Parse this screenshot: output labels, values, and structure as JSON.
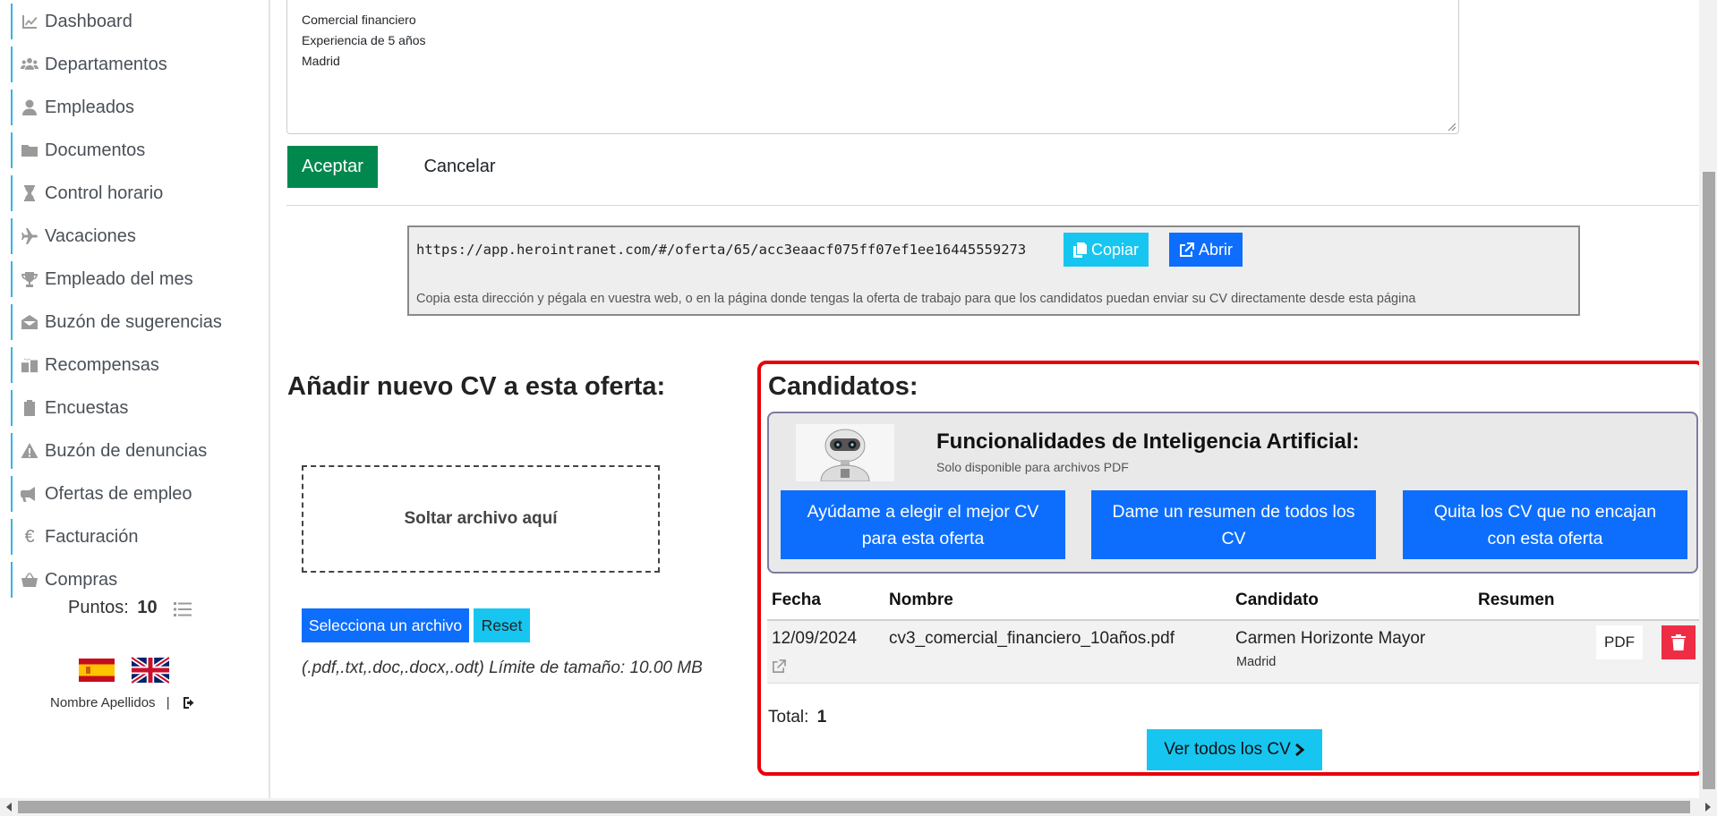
{
  "sidebar": {
    "items": [
      {
        "label": "Dashboard",
        "icon": "chart-line-icon"
      },
      {
        "label": "Departamentos",
        "icon": "users-icon"
      },
      {
        "label": "Empleados",
        "icon": "user-icon"
      },
      {
        "label": "Documentos",
        "icon": "folder-icon"
      },
      {
        "label": "Control horario",
        "icon": "hourglass-icon"
      },
      {
        "label": "Vacaciones",
        "icon": "plane-icon"
      },
      {
        "label": "Empleado del mes",
        "icon": "trophy-icon"
      },
      {
        "label": "Buzón de sugerencias",
        "icon": "envelope-open-icon"
      },
      {
        "label": "Recompensas",
        "icon": "gifts-icon"
      },
      {
        "label": "Encuestas",
        "icon": "clipboard-icon"
      },
      {
        "label": "Buzón de denuncias",
        "icon": "warning-icon"
      },
      {
        "label": "Ofertas de empleo",
        "icon": "bullhorn-icon"
      },
      {
        "label": "Facturación",
        "icon": "euro-icon"
      },
      {
        "label": "Compras",
        "icon": "basket-icon"
      }
    ],
    "points_label": "Puntos:",
    "points_value": "10",
    "user_name": "Nombre Apellidos",
    "separator": "|"
  },
  "form": {
    "description_lines": [
      "Comercial financiero",
      "Experiencia de 5 años",
      "Madrid"
    ],
    "accept_label": "Aceptar",
    "cancel_label": "Cancelar"
  },
  "share": {
    "url": "https://app.herointranet.com/#/oferta/65/acc3eaacf075ff07ef1ee16445559273",
    "copy_label": "Copiar",
    "open_label": "Abrir",
    "help": "Copia esta dirección y pégala en vuestra web, o en la página donde tengas la oferta de trabajo para que los candidatos puedan enviar su CV directamente desde esta página"
  },
  "upload": {
    "title": "Añadir nuevo CV a esta oferta:",
    "dropzone": "Soltar archivo aquí",
    "select_label": "Selecciona un archivo",
    "reset_label": "Reset",
    "hint": "(.pdf,.txt,.doc,.docx,.odt) Límite de tamaño: 10.00 MB"
  },
  "candidates": {
    "title": "Candidatos:",
    "ai_title": "Funcionalidades de Inteligencia Artificial:",
    "ai_subtitle": "Solo disponible para archivos PDF",
    "ai_buttons": [
      "Ayúdame a elegir el mejor CV para esta oferta",
      "Dame un resumen de todos los CV",
      "Quita los CV que no encajan con esta oferta"
    ],
    "columns": [
      "Fecha",
      "Nombre",
      "Candidato",
      "Resumen"
    ],
    "rows": [
      {
        "fecha": "12/09/2024",
        "nombre": "cv3_comercial_financiero_10años.pdf",
        "candidato": "Carmen Horizonte Mayor",
        "ciudad": "Madrid",
        "pdf": "PDF"
      }
    ],
    "total_label": "Total:",
    "total_value": "1",
    "view_all_label": "Ver todos los CV"
  },
  "colors": {
    "accent_green": "#00884f",
    "accent_blue": "#0d6efd",
    "accent_cyan": "#17c6f0",
    "highlight_red": "#e8000b",
    "delete_red": "#ee2d45"
  }
}
